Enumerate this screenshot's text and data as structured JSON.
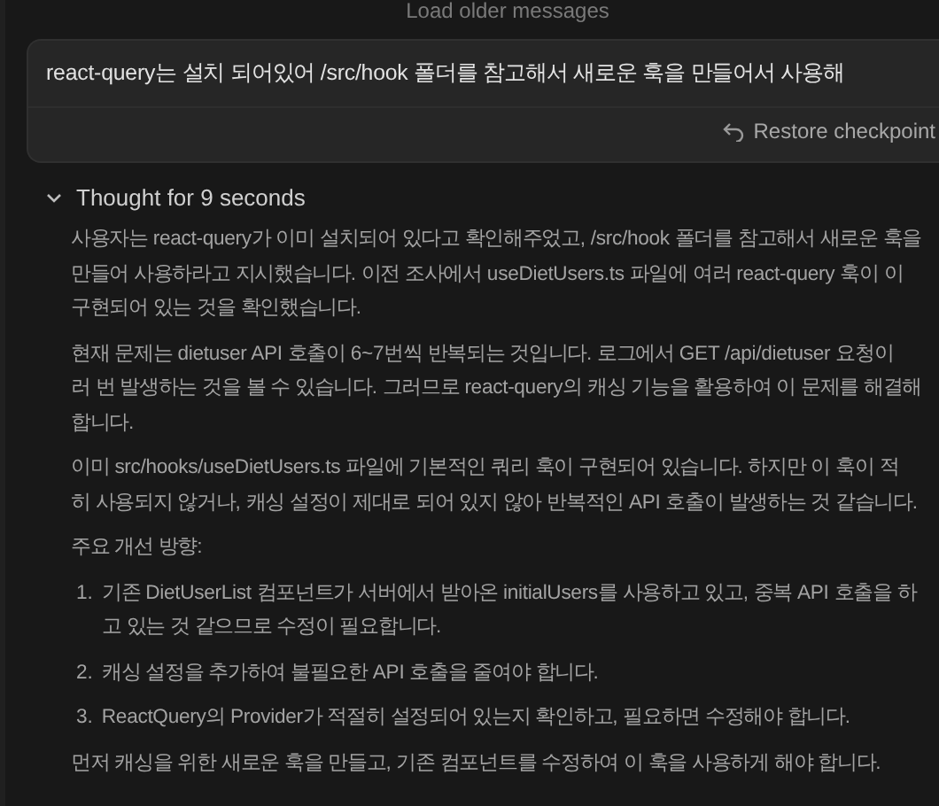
{
  "load_older": "Load older messages",
  "user_message": {
    "text": "react-query는 설치 되어있어 /src/hook 폴더를 참고해서 새로운 훅을 만들어서 사용해",
    "restore_label": "Restore checkpoint"
  },
  "thought": {
    "label": "Thought for 9 seconds",
    "expanded": true,
    "blocks": [
      {
        "kind": "paragraph",
        "lines": [
          "사용자는 react-query가 이미 설치되어 있다고 확인해주었고, /src/hook 폴더를 참고해서 새로운 훅을",
          "만들어 사용하라고 지시했습니다. 이전 조사에서 useDietUsers.ts 파일에 여러 react-query 훅이 이",
          "구현되어 있는 것을 확인했습니다."
        ]
      },
      {
        "kind": "paragraph",
        "lines": [
          "현재 문제는 dietuser API 호출이 6~7번씩 반복되는 것입니다. 로그에서 GET /api/dietuser 요청이",
          "러 번 발생하는 것을 볼 수 있습니다. 그러므로 react-query의 캐싱 기능을 활용하여 이 문제를 해결해",
          "합니다."
        ]
      },
      {
        "kind": "paragraph",
        "lines": [
          "이미 src/hooks/useDietUsers.ts 파일에 기본적인 쿼리 훅이 구현되어 있습니다. 하지만 이 훅이 적",
          "히 사용되지 않거나, 캐싱 설정이 제대로 되어 있지 않아 반복적인 API 호출이 발생하는 것 같습니다."
        ]
      },
      {
        "kind": "paragraph",
        "lines": [
          "주요 개선 방향:"
        ]
      },
      {
        "kind": "list_item",
        "number": "1.",
        "lines": [
          "기존 DietUserList 컴포넌트가 서버에서 받아온 initialUsers를 사용하고 있고, 중복 API 호출을 하",
          "고 있는 것 같으므로 수정이 필요합니다."
        ]
      },
      {
        "kind": "list_item",
        "number": "2.",
        "lines": [
          "캐싱 설정을 추가하여 불필요한 API 호출을 줄여야 합니다."
        ]
      },
      {
        "kind": "list_item",
        "number": "3.",
        "lines": [
          "ReactQuery의 Provider가 적절히 설정되어 있는지 확인하고, 필요하면 수정해야 합니다."
        ]
      },
      {
        "kind": "paragraph",
        "lines": [
          "먼저 캐싱을 위한 새로운 훅을 만들고, 기존 컴포넌트를 수정하여 이 훅을 사용하게 해야 합니다."
        ]
      }
    ]
  }
}
